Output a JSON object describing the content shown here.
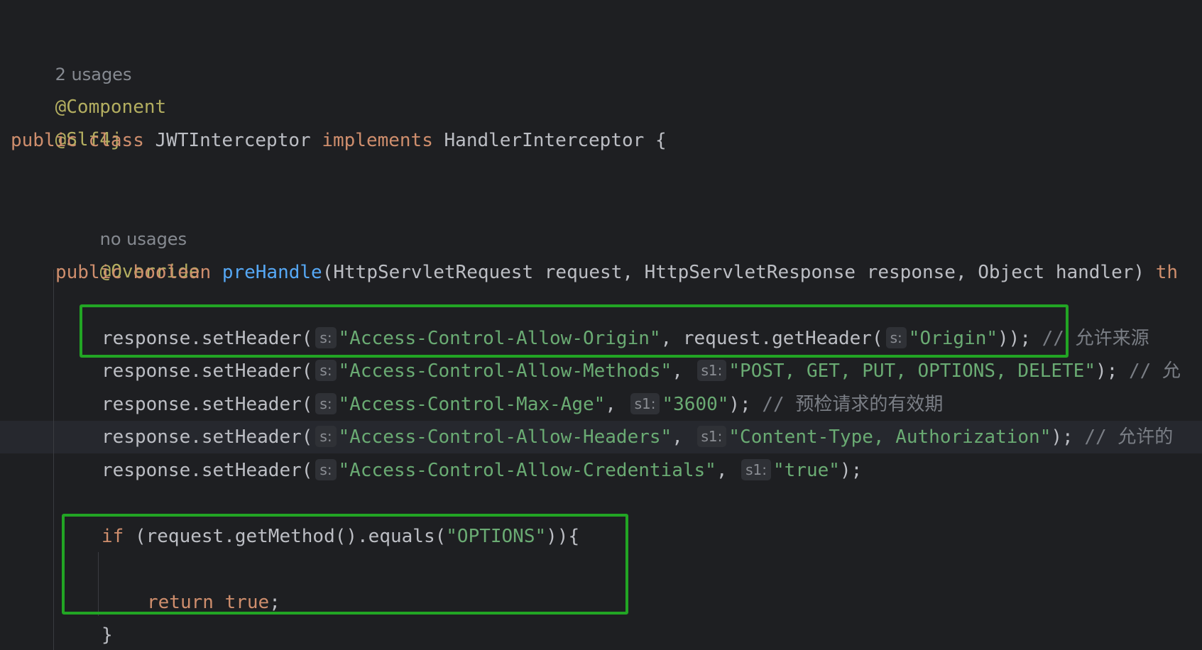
{
  "usages": {
    "class_usages": "2 usages",
    "method_usages": "no usages"
  },
  "annotations": {
    "component": "@Component",
    "slf4j": "@Slf4j",
    "override": "@Override"
  },
  "class_decl": {
    "kw_public": "public",
    "kw_class": "class",
    "name": "JWTInterceptor",
    "kw_implements": "implements",
    "iface": "HandlerInterceptor",
    "brace": "{"
  },
  "method_decl": {
    "kw_public": "public",
    "kw_boolean": "boolean",
    "name": "preHandle",
    "params": "(HttpServletRequest request, HttpServletResponse response, Object handler)",
    "throws_fragment": "th"
  },
  "header_lines": [
    {
      "call": "response.setHeader(",
      "hint1": "s:",
      "arg1": "\"Access-Control-Allow-Origin\"",
      "mid": ", request.getHeader(",
      "hint2": "s:",
      "arg2": "\"Origin\"",
      "end": "));",
      "comment": "// 允许来源"
    },
    {
      "call": "response.setHeader(",
      "hint1": "s:",
      "arg1": "\"Access-Control-Allow-Methods\"",
      "mid": ", ",
      "hint2": "s1:",
      "arg2": "\"POST, GET, PUT, OPTIONS, DELETE\"",
      "end": ");",
      "comment": "// 允"
    },
    {
      "call": "response.setHeader(",
      "hint1": "s:",
      "arg1": "\"Access-Control-Max-Age\"",
      "mid": ", ",
      "hint2": "s1:",
      "arg2": "\"3600\"",
      "end": ");",
      "comment": "// 预检请求的有效期"
    },
    {
      "call": "response.setHeader(",
      "hint1": "s:",
      "arg1": "\"Access-Control-Allow-Headers\"",
      "mid": ", ",
      "hint2": "s1:",
      "arg2": "\"Content-Type, Authorization\"",
      "end": ");",
      "comment": "// 允许的"
    },
    {
      "call": "response.setHeader(",
      "hint1": "s:",
      "arg1": "\"Access-Control-Allow-Credentials\"",
      "mid": ", ",
      "hint2": "s1:",
      "arg2": "\"true\"",
      "end": ");",
      "comment": ""
    }
  ],
  "if_block": {
    "kw_if": "if",
    "cond_start": " (request.getMethod().equals(",
    "cond_str": "\"OPTIONS\"",
    "cond_end": ")){",
    "kw_return": "return",
    "kw_true": "true",
    "semi": ";",
    "close": "}"
  },
  "colors": {
    "background": "#1e1f22",
    "keyword": "#cf8e6d",
    "annotation": "#b3ae60",
    "string": "#6aab73",
    "function": "#56a8f5",
    "comment": "#7a7e85",
    "highlight_box": "#22a524"
  }
}
